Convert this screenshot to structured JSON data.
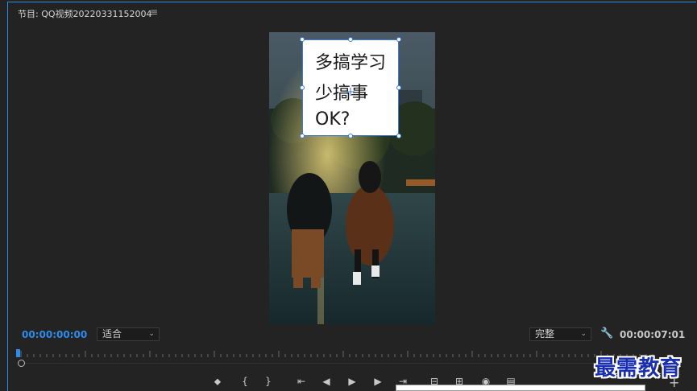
{
  "panel": {
    "title": "节目: QQ视频20220331152004",
    "menu_icon": "hamburger-icon"
  },
  "overlay_text": {
    "line1": "多搞学习",
    "line2": "少搞事",
    "line3": "OK?"
  },
  "transport": {
    "current_timecode": "00:00:00:00",
    "duration_timecode": "00:00:07:01",
    "zoom_select": "适合",
    "quality_select": "完整",
    "playhead_position": 0
  },
  "controls": [
    {
      "name": "add-marker-button",
      "glyph": "⬥"
    },
    {
      "name": "mark-in-button",
      "glyph": "{"
    },
    {
      "name": "mark-out-button",
      "glyph": "}"
    },
    {
      "name": "go-to-in-button",
      "glyph": "⇤"
    },
    {
      "name": "step-back-button",
      "glyph": "◀"
    },
    {
      "name": "play-button",
      "glyph": "▶"
    },
    {
      "name": "step-forward-button",
      "glyph": "▶"
    },
    {
      "name": "go-to-out-button",
      "glyph": "⇥"
    },
    {
      "name": "lift-button",
      "glyph": "⊟"
    },
    {
      "name": "extract-button",
      "glyph": "⊞"
    },
    {
      "name": "export-frame-button",
      "glyph": "◉"
    },
    {
      "name": "comparison-view-button",
      "glyph": "▤"
    }
  ],
  "watermark": "最需教育",
  "colors": {
    "accent": "#2d8ceb",
    "background": "#232323",
    "watermark": "#1a2fb0"
  }
}
